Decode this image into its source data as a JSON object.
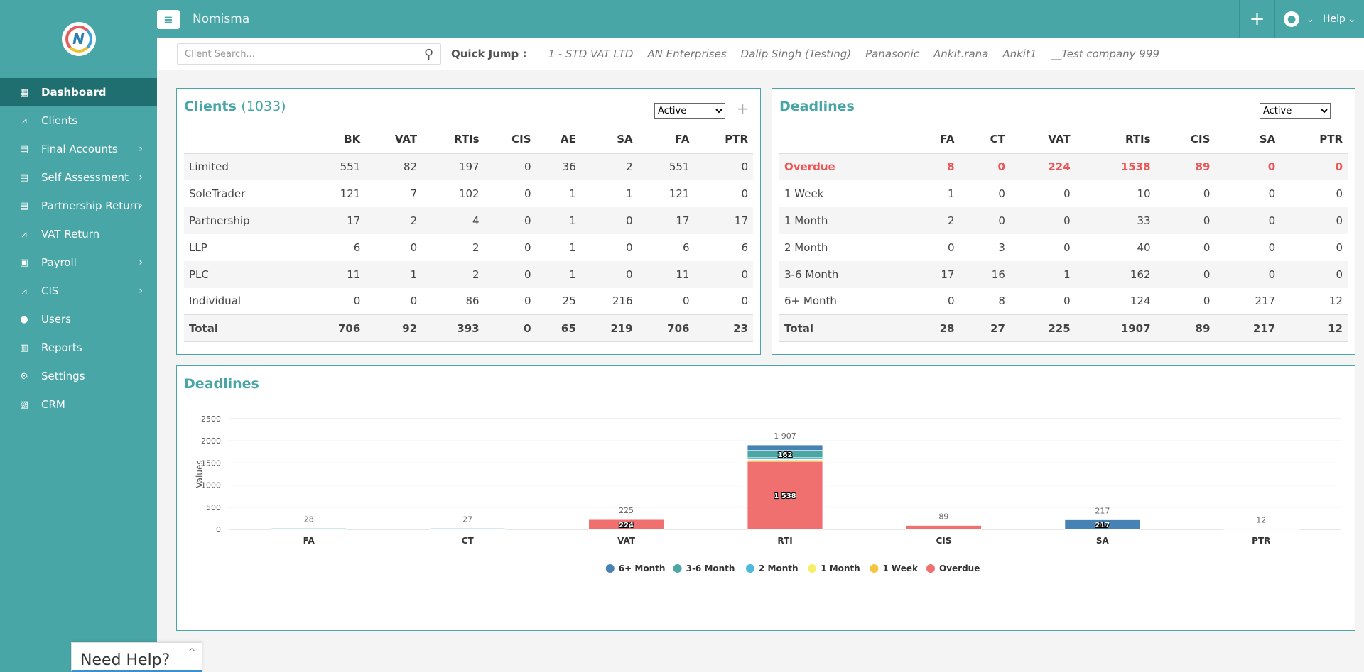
{
  "app": {
    "brand": "Nomisma",
    "help_label": "Help"
  },
  "sidebar": {
    "items": [
      {
        "label": "Dashboard",
        "icon": "dashboard-icon",
        "active": true,
        "arrow": false
      },
      {
        "label": "Clients",
        "icon": "chart-icon",
        "active": false,
        "arrow": false
      },
      {
        "label": "Final Accounts",
        "icon": "folder-icon",
        "active": false,
        "arrow": true
      },
      {
        "label": "Self Assessment",
        "icon": "folder-icon",
        "active": false,
        "arrow": true
      },
      {
        "label": "Partnership Return",
        "icon": "folder-icon",
        "active": false,
        "arrow": true
      },
      {
        "label": "VAT Return",
        "icon": "chart-icon",
        "active": false,
        "arrow": false
      },
      {
        "label": "Payroll",
        "icon": "payroll-icon",
        "active": false,
        "arrow": true
      },
      {
        "label": "CIS",
        "icon": "chart-icon",
        "active": false,
        "arrow": true
      },
      {
        "label": "Users",
        "icon": "user-icon",
        "active": false,
        "arrow": false
      },
      {
        "label": "Reports",
        "icon": "report-icon",
        "active": false,
        "arrow": false
      },
      {
        "label": "Settings",
        "icon": "settings-icon",
        "active": false,
        "arrow": false
      },
      {
        "label": "CRM",
        "icon": "crm-icon",
        "active": false,
        "arrow": false
      }
    ]
  },
  "quickbar": {
    "search_placeholder": "Client Search...",
    "label": "Quick Jump :",
    "links": [
      "1 - STD VAT LTD",
      "AN Enterprises",
      "Dalip Singh (Testing)",
      "Panasonic",
      "Ankit.rana",
      "Ankit1",
      "__Test company 999"
    ]
  },
  "clients": {
    "title": "Clients",
    "count": "(1033)",
    "filter": "Active",
    "headers": [
      "",
      "BK",
      "VAT",
      "RTIs",
      "CIS",
      "AE",
      "SA",
      "FA",
      "PTR"
    ],
    "rows": [
      [
        "Limited",
        "551",
        "82",
        "197",
        "0",
        "36",
        "2",
        "551",
        "0"
      ],
      [
        "SoleTrader",
        "121",
        "7",
        "102",
        "0",
        "1",
        "1",
        "121",
        "0"
      ],
      [
        "Partnership",
        "17",
        "2",
        "4",
        "0",
        "1",
        "0",
        "17",
        "17"
      ],
      [
        "LLP",
        "6",
        "0",
        "2",
        "0",
        "1",
        "0",
        "6",
        "6"
      ],
      [
        "PLC",
        "11",
        "1",
        "2",
        "0",
        "1",
        "0",
        "11",
        "0"
      ],
      [
        "Individual",
        "0",
        "0",
        "86",
        "0",
        "25",
        "216",
        "0",
        "0"
      ]
    ],
    "total": [
      "Total",
      "706",
      "92",
      "393",
      "0",
      "65",
      "219",
      "706",
      "23"
    ]
  },
  "deadlines": {
    "title": "Deadlines",
    "filter": "Active",
    "headers": [
      "",
      "FA",
      "CT",
      "VAT",
      "RTIs",
      "CIS",
      "SA",
      "PTR"
    ],
    "rows": [
      [
        "Overdue",
        "8",
        "0",
        "224",
        "1538",
        "89",
        "0",
        "0"
      ],
      [
        "1 Week",
        "1",
        "0",
        "0",
        "10",
        "0",
        "0",
        "0"
      ],
      [
        "1 Month",
        "2",
        "0",
        "0",
        "33",
        "0",
        "0",
        "0"
      ],
      [
        "2 Month",
        "0",
        "3",
        "0",
        "40",
        "0",
        "0",
        "0"
      ],
      [
        "3-6 Month",
        "17",
        "16",
        "1",
        "162",
        "0",
        "0",
        "0"
      ],
      [
        "6+ Month",
        "0",
        "8",
        "0",
        "124",
        "0",
        "217",
        "12"
      ]
    ],
    "total": [
      "Total",
      "28",
      "27",
      "225",
      "1907",
      "89",
      "217",
      "12"
    ]
  },
  "chart_panel": {
    "title": "Deadlines"
  },
  "chart_data": {
    "type": "bar",
    "stacked": true,
    "categories": [
      "FA",
      "CT",
      "VAT",
      "RTI",
      "CIS",
      "SA",
      "PTR"
    ],
    "ylabel": "Values",
    "ylim": [
      0,
      2500
    ],
    "yticks": [
      0,
      500,
      1000,
      1500,
      2000,
      2500
    ],
    "grid": true,
    "legend_position": "bottom",
    "totals": [
      "28",
      "27",
      "225",
      "1 907",
      "89",
      "217",
      "12"
    ],
    "series": [
      {
        "name": "Overdue",
        "color": "#f07070",
        "values": [
          8,
          0,
          224,
          1538,
          89,
          0,
          0
        ],
        "labels": [
          "",
          "",
          "224",
          "1 538",
          "",
          "",
          ""
        ]
      },
      {
        "name": "1 Week",
        "color": "#f4c542",
        "values": [
          1,
          0,
          0,
          10,
          0,
          0,
          0
        ],
        "labels": [
          "",
          "",
          "",
          "",
          "",
          "",
          ""
        ]
      },
      {
        "name": "1 Month",
        "color": "#f6ef6a",
        "values": [
          2,
          0,
          0,
          33,
          0,
          0,
          0
        ],
        "labels": [
          "",
          "",
          "",
          "",
          "",
          "",
          ""
        ]
      },
      {
        "name": "2 Month",
        "color": "#4fb8e0",
        "values": [
          0,
          3,
          0,
          40,
          0,
          0,
          0
        ],
        "labels": [
          "",
          "",
          "",
          "",
          "",
          "",
          ""
        ]
      },
      {
        "name": "3-6 Month",
        "color": "#4aa8a4",
        "values": [
          17,
          16,
          1,
          162,
          0,
          0,
          0
        ],
        "labels": [
          "",
          "",
          "",
          "162",
          "",
          "",
          ""
        ]
      },
      {
        "name": "6+ Month",
        "color": "#4682b4",
        "values": [
          0,
          8,
          0,
          124,
          0,
          217,
          12
        ],
        "labels": [
          "",
          "",
          "",
          "",
          "",
          "217",
          ""
        ]
      }
    ]
  },
  "need_help": {
    "label": "Need Help?"
  }
}
